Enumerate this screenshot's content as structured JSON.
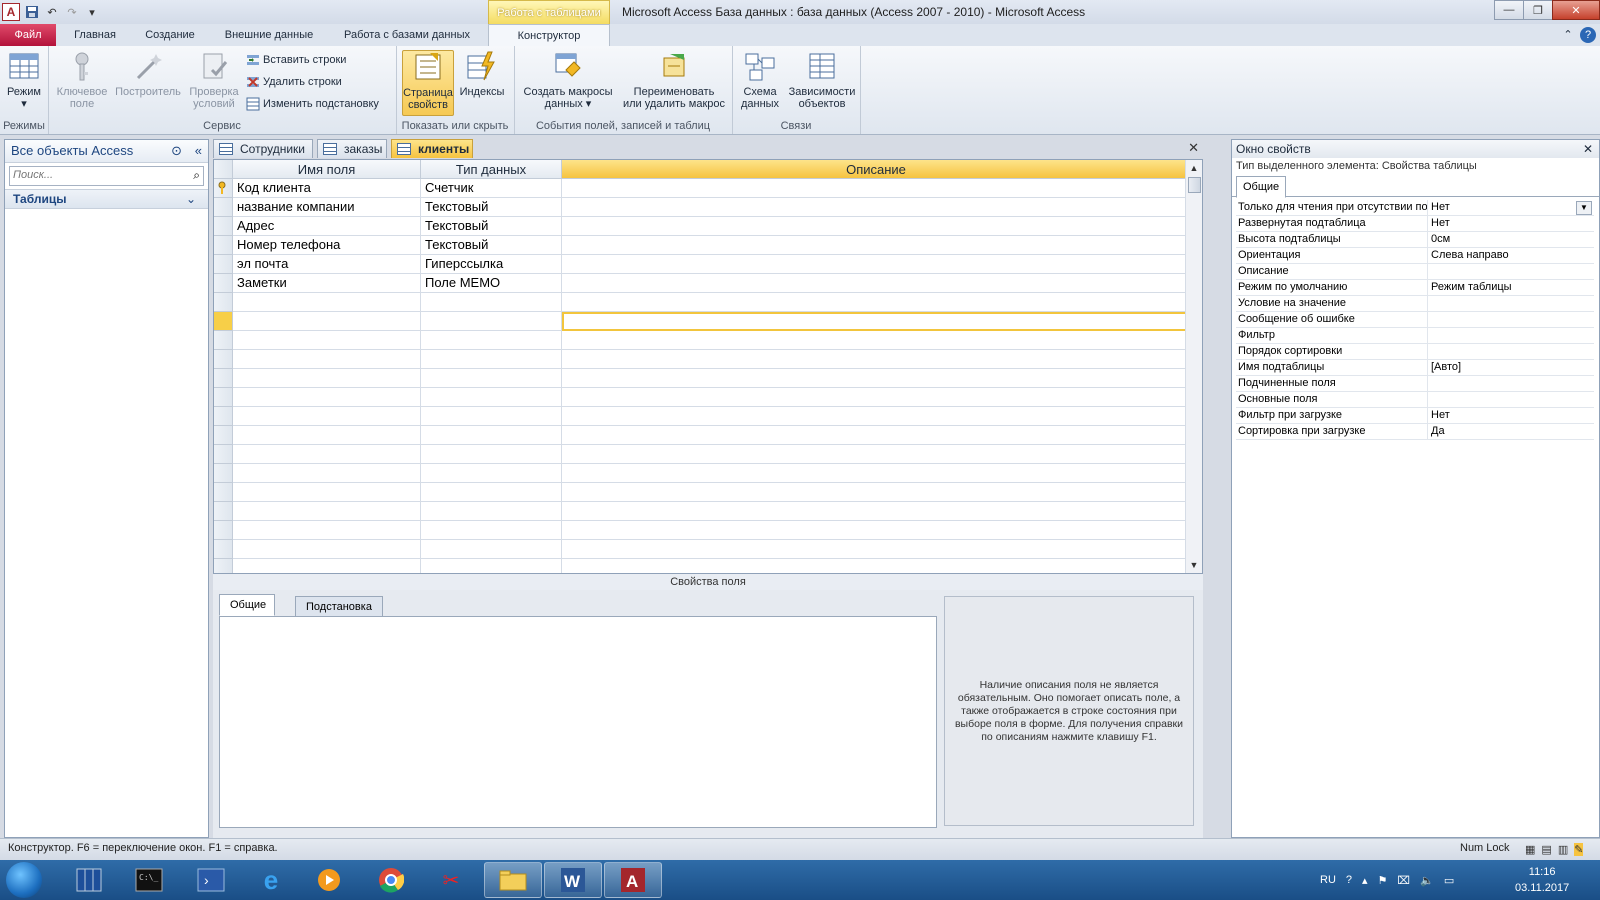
{
  "window": {
    "title": "Microsoft Access База данных : база данных (Access 2007 - 2010)  -  Microsoft Access",
    "context_tab": "Работа с таблицами"
  },
  "ribbon_tabs": [
    "Файл",
    "Главная",
    "Создание",
    "Внешние данные",
    "Работа с базами данных",
    "Конструктор"
  ],
  "ribbon": {
    "groups": {
      "modes": "Режимы",
      "tools": "Сервис",
      "show_hide": "Показать или скрыть",
      "events": "События полей, записей и таблиц",
      "relations": "Связи"
    },
    "buttons": {
      "view": "Режим",
      "primary_key": [
        "Ключевое",
        "поле"
      ],
      "builder": "Построитель",
      "test_rules": [
        "Проверка",
        "условий"
      ],
      "insert_rows": "Вставить строки",
      "delete_rows": "Удалить строки",
      "modify_lookups": "Изменить подстановку",
      "property_sheet": [
        "Страница",
        "свойств"
      ],
      "indexes": "Индексы",
      "create_macros": [
        "Создать макросы",
        "данных"
      ],
      "rename_macro": [
        "Переименовать",
        "или удалить макрос"
      ],
      "relationships": [
        "Схема",
        "данных"
      ],
      "dependencies": [
        "Зависимости",
        "объектов"
      ]
    }
  },
  "nav_pane": {
    "title": "Все объекты Access",
    "search_placeholder": "Поиск...",
    "group": "Таблицы"
  },
  "doc_tabs": [
    "Сотрудники",
    "заказы",
    "клиенты"
  ],
  "design_grid": {
    "headers": [
      "Имя поля",
      "Тип данных",
      "Описание"
    ],
    "rows": [
      {
        "name": "Код клиента",
        "type": "Счетчик",
        "desc": "",
        "key": true
      },
      {
        "name": "название компании",
        "type": "Текстовый",
        "desc": ""
      },
      {
        "name": "Адрес",
        "type": "Текстовый",
        "desc": ""
      },
      {
        "name": "Номер телефона",
        "type": "Текстовый",
        "desc": ""
      },
      {
        "name": "эл почта",
        "type": "Гиперссылка",
        "desc": ""
      },
      {
        "name": "Заметки",
        "type": "Поле MEMO",
        "desc": ""
      }
    ]
  },
  "field_properties": {
    "label": "Свойства поля",
    "tabs": [
      "Общие",
      "Подстановка"
    ],
    "help": "Наличие описания поля не является обязательным. Оно помогает описать поле, а также отображается в строке состояния при выборе поля в форме. Для получения справки по описаниям нажмите клавишу F1."
  },
  "property_sheet": {
    "title": "Окно свойств",
    "selection_type": "Тип выделенного элемента:  Свойства таблицы",
    "tab": "Общие",
    "rows": [
      {
        "label": "Только для чтения при отсутствии подключения",
        "value": "Нет"
      },
      {
        "label": "Развернутая подтаблица",
        "value": "Нет"
      },
      {
        "label": "Высота подтаблицы",
        "value": "0см"
      },
      {
        "label": "Ориентация",
        "value": "Слева направо"
      },
      {
        "label": "Описание",
        "value": ""
      },
      {
        "label": "Режим по умолчанию",
        "value": "Режим таблицы"
      },
      {
        "label": "Условие на значение",
        "value": ""
      },
      {
        "label": "Сообщение об ошибке",
        "value": ""
      },
      {
        "label": "Фильтр",
        "value": ""
      },
      {
        "label": "Порядок сортировки",
        "value": ""
      },
      {
        "label": "Имя подтаблицы",
        "value": "[Авто]"
      },
      {
        "label": "Подчиненные поля",
        "value": ""
      },
      {
        "label": "Основные поля",
        "value": ""
      },
      {
        "label": "Фильтр при загрузке",
        "value": "Нет"
      },
      {
        "label": "Сортировка при загрузке",
        "value": "Да"
      }
    ]
  },
  "status": {
    "text": "Конструктор.  F6 = переключение окон.  F1 = справка.",
    "numlock": "Num Lock"
  },
  "taskbar": {
    "lang": "RU",
    "time": "11:16",
    "date": "03.11.2017"
  },
  "colors": {
    "access_red": "#a4262c",
    "highlight_yellow": "#f6c340",
    "file_tab": "#b3123a",
    "taskbar": "#1a4e86"
  }
}
